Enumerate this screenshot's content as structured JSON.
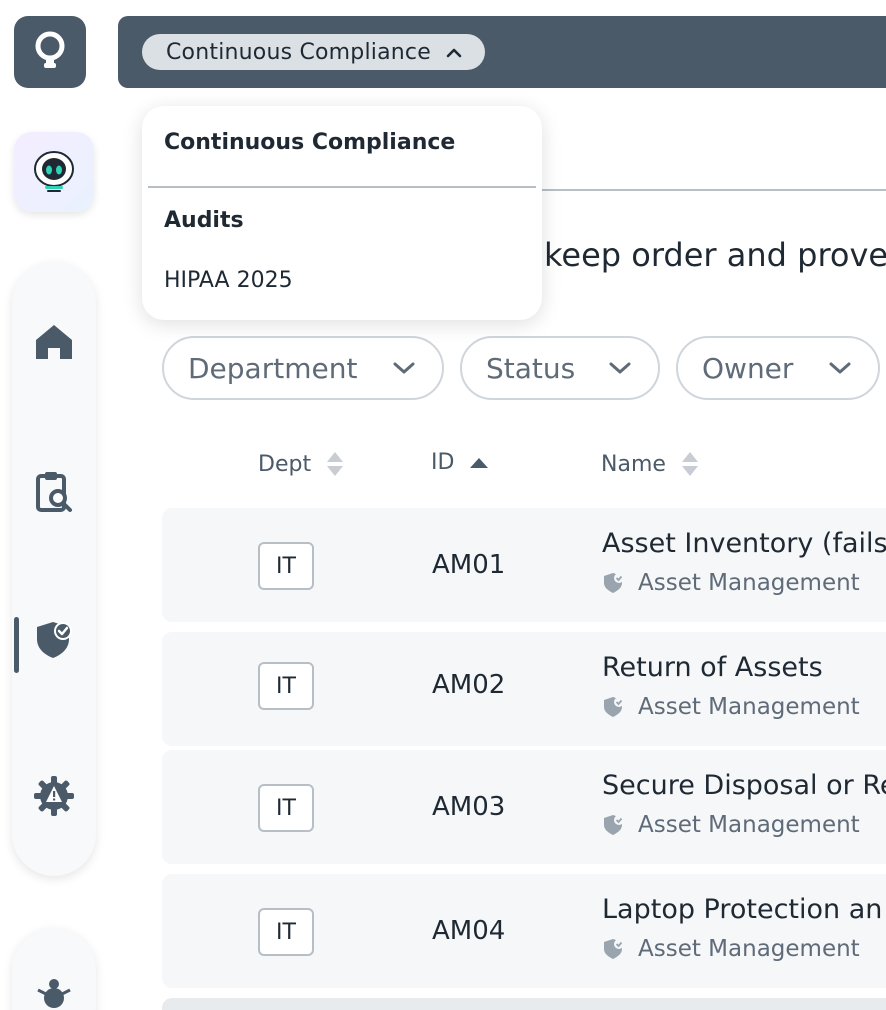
{
  "topbar": {
    "breadcrumb_label": "Continuous Compliance"
  },
  "intro": {
    "text_fragment": "keep order and prove"
  },
  "dropdown": {
    "title": "Continuous Compliance",
    "section": "Audits",
    "item": "HIPAA 2025"
  },
  "filters": [
    {
      "label": "Department"
    },
    {
      "label": "Status"
    },
    {
      "label": "Owner"
    }
  ],
  "table": {
    "columns": [
      {
        "label": "Dept",
        "sort": "none"
      },
      {
        "label": "ID",
        "sort": "ascending"
      },
      {
        "label": "Name",
        "sort": "none"
      }
    ],
    "rows": [
      {
        "dept": "IT",
        "id": "AM01",
        "name": "Asset Inventory (fails",
        "category": "Asset Management"
      },
      {
        "dept": "IT",
        "id": "AM02",
        "name": "Return of Assets",
        "category": "Asset Management"
      },
      {
        "dept": "IT",
        "id": "AM03",
        "name": "Secure Disposal or Re",
        "category": "Asset Management"
      },
      {
        "dept": "IT",
        "id": "AM04",
        "name": "Laptop Protection an",
        "category": "Asset Management"
      }
    ]
  },
  "colors": {
    "topbar_bg": "#4b5a69",
    "crumb_bg": "#dbe0e5",
    "row_bg": "#f6f7f9",
    "text_primary": "#1f2933",
    "text_muted": "#5f6b78",
    "active_indicator": "#4b5a69"
  },
  "icons": {
    "logo": "lightbulb-icon",
    "assistant": "robot-avatar-icon",
    "nav_home": "home-icon",
    "nav_audits": "clipboard-search-icon",
    "nav_compliance": "shield-check-icon",
    "nav_settings": "gear-warning-icon",
    "nav_bottom": "bug-icon",
    "category": "shield-small-icon",
    "sort_both": "sort-icon",
    "sort_asc": "sort-asc-icon",
    "filter_chevron": "chevron-down-icon",
    "crumb_chevron": "chevron-up-icon"
  }
}
